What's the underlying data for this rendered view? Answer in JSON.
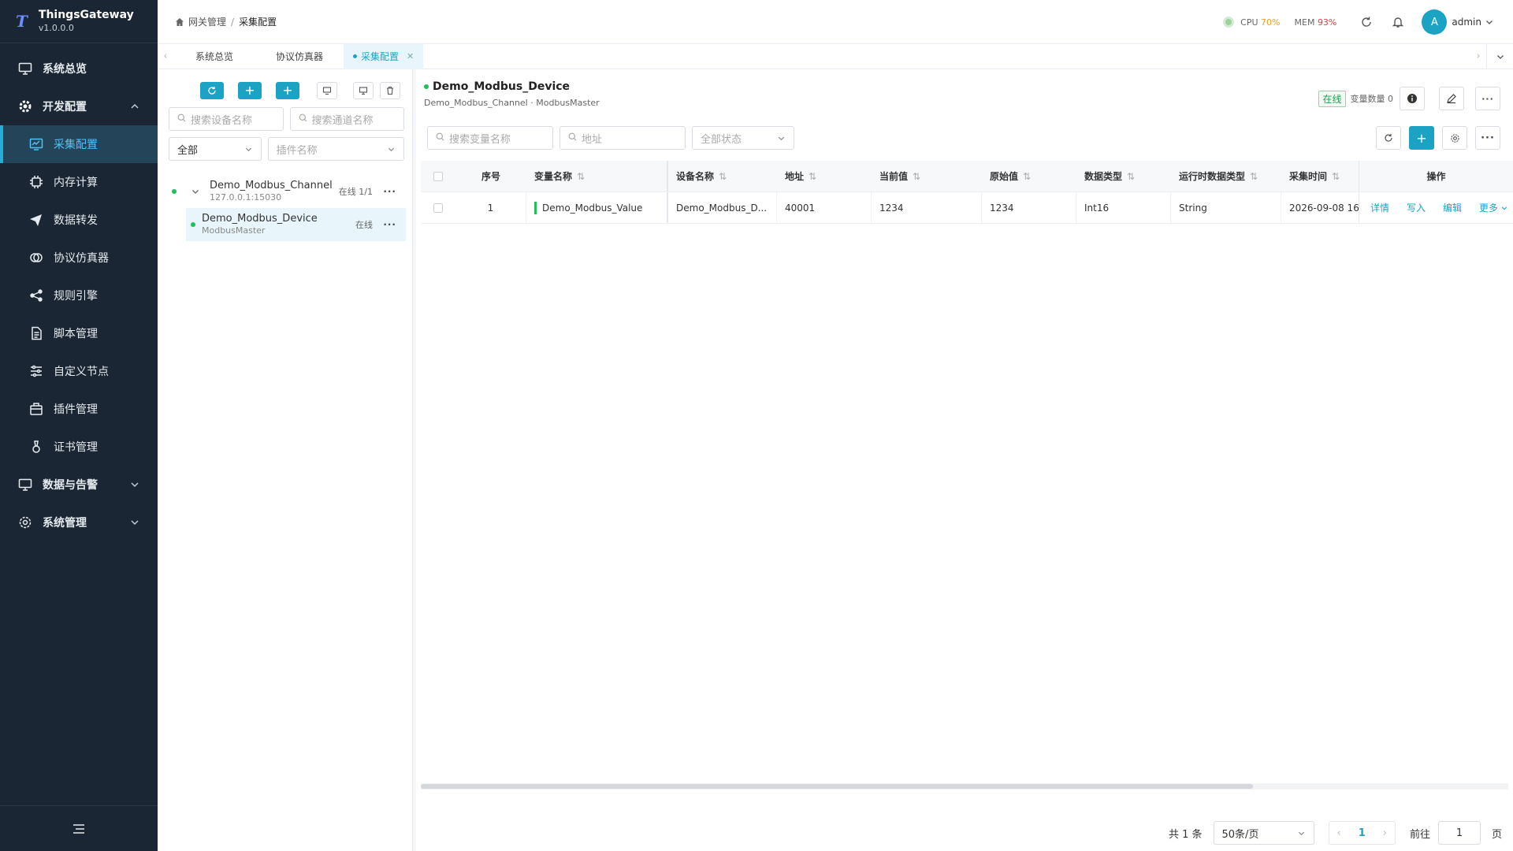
{
  "app": {
    "name": "ThingsGateway",
    "version": "v1.0.0.0",
    "logo_mark": "T"
  },
  "sidebar": {
    "items": [
      {
        "label": "系统总览",
        "icon": "monitor-icon"
      },
      {
        "label": "开发配置",
        "icon": "gear-icon"
      },
      {
        "label": "采集配置",
        "icon": "chart-icon"
      },
      {
        "label": "内存计算",
        "icon": "chip-icon"
      },
      {
        "label": "数据转发",
        "icon": "send-icon"
      },
      {
        "label": "协议仿真器",
        "icon": "sim-icon"
      },
      {
        "label": "规则引擎",
        "icon": "share-icon"
      },
      {
        "label": "脚本管理",
        "icon": "doc-icon"
      },
      {
        "label": "自定义节点",
        "icon": "sliders-icon"
      },
      {
        "label": "插件管理",
        "icon": "plugin-icon"
      },
      {
        "label": "证书管理",
        "icon": "cert-icon"
      },
      {
        "label": "数据与告警",
        "icon": "alarm-icon"
      },
      {
        "label": "系统管理",
        "icon": "settings-icon"
      }
    ]
  },
  "header": {
    "breadcrumb": [
      "网关管理",
      "采集配置"
    ],
    "cpu_label": "CPU",
    "cpu_value": "70%",
    "mem_label": "MEM",
    "mem_value": "93%",
    "user_initial": "A",
    "user_name": "admin",
    "colors": {
      "cpu": "#f0a020",
      "mem": "#e04040",
      "accent": "#1ca3c4"
    }
  },
  "tabs": [
    {
      "label": "系统总览"
    },
    {
      "label": "协议仿真器"
    },
    {
      "label": "采集配置"
    }
  ],
  "left_panel": {
    "search_device_placeholder": "搜索设备名称",
    "search_channel_placeholder": "搜索通道名称",
    "filter_value": "全部",
    "plugin_placeholder": "插件名称",
    "channel": {
      "name": "Demo_Modbus_Channel",
      "address": "127.0.0.1:15030",
      "status": "在线 1/1"
    },
    "device": {
      "name": "Demo_Modbus_Device",
      "plugin": "ModbusMaster",
      "status": "在线"
    }
  },
  "main": {
    "device_title": "Demo_Modbus_Device",
    "device_sub": "Demo_Modbus_Channel · ModbusMaster",
    "status_tag": "在线",
    "var_count_label": "变量数量 0",
    "search_var_placeholder": "搜索变量名称",
    "address_placeholder": "地址",
    "status_filter": "全部状态",
    "columns": [
      "序号",
      "变量名称",
      "设备名称",
      "地址",
      "当前值",
      "原始值",
      "数据类型",
      "运行时数据类型",
      "采集时间",
      "操作"
    ],
    "rows": [
      {
        "index": "1",
        "name": "Demo_Modbus_Value",
        "device": "Demo_Modbus_D...",
        "address": "40001",
        "current": "1234",
        "raw": "1234",
        "type": "Int16",
        "runtime_type": "String",
        "time": "2026-09-08 16:"
      }
    ],
    "row_actions": [
      "详情",
      "写入",
      "编辑",
      "更多"
    ],
    "pagination": {
      "total": "共 1 条",
      "page_size": "50条/页",
      "current_page": "1",
      "goto_label": "前往",
      "goto_value": "1",
      "page_unit": "页"
    }
  }
}
